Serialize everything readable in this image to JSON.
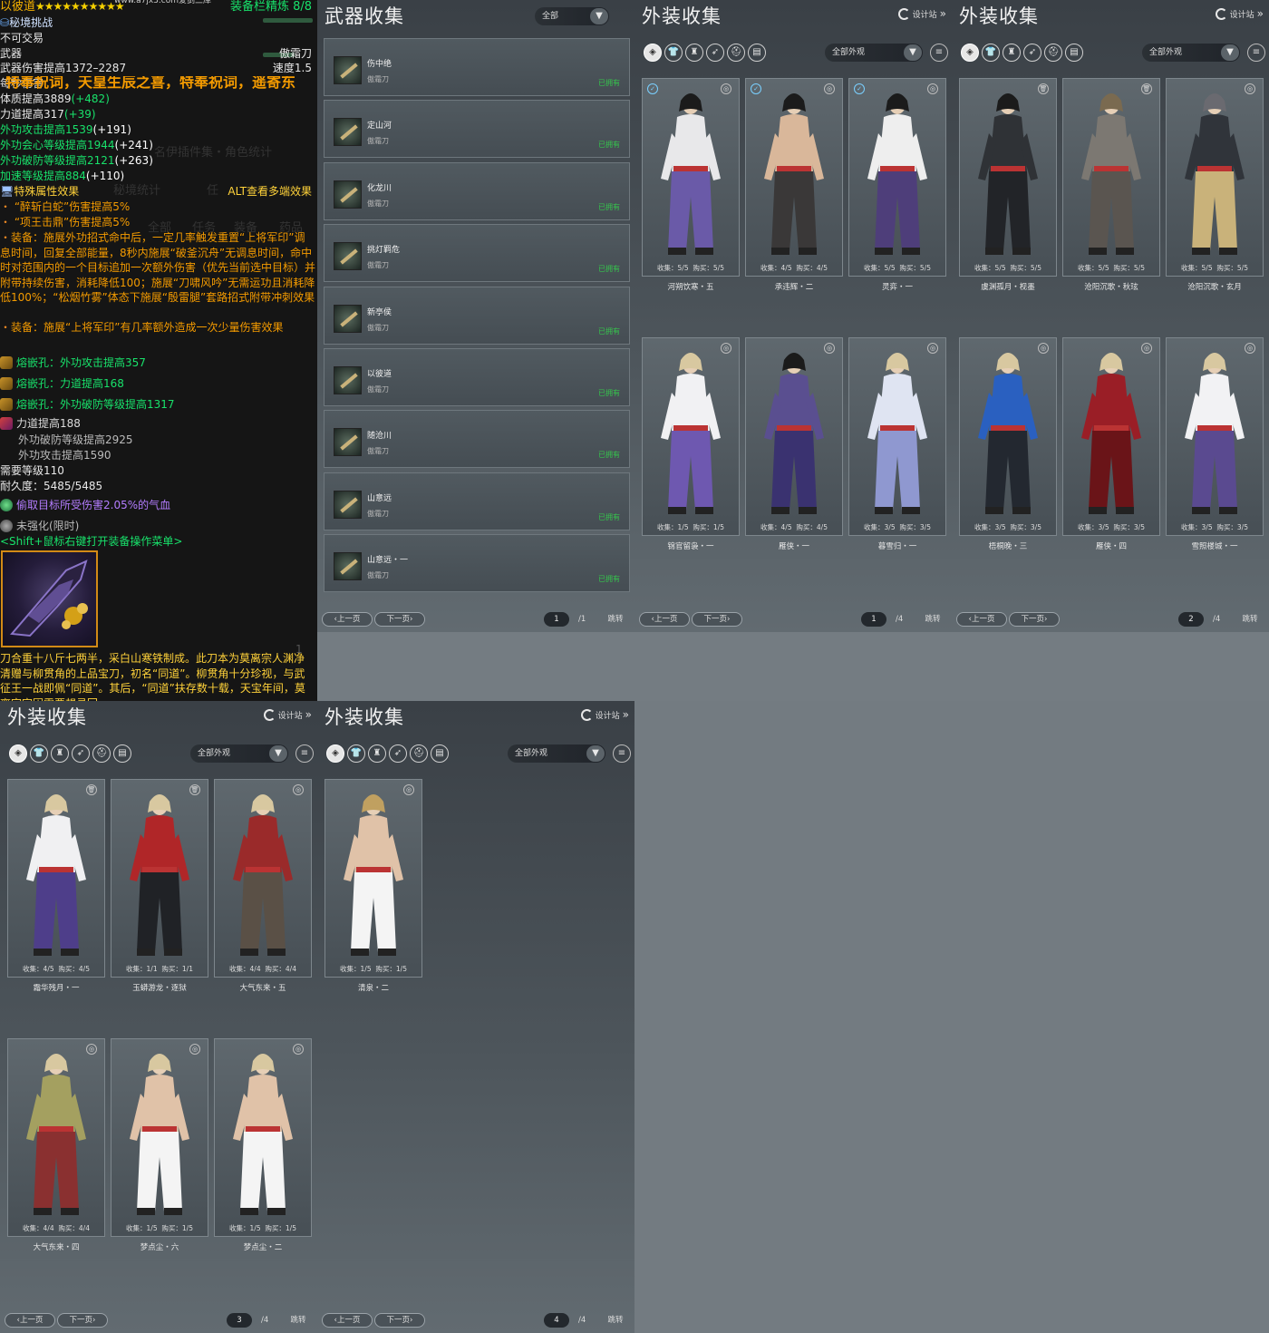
{
  "tooltip": {
    "watermark": "www.a7jx3.com爱剑三库",
    "name": "以彼道",
    "stars": "★★★★★★★★★★",
    "refine": "装备栏精炼 8/8",
    "challenge": "秘境挑战",
    "untradeable": "不可交易",
    "type": "武器",
    "weapon_class": "傲霜刀",
    "damage": "武器伤害提高1372–2287",
    "speed": "速度1.5",
    "dps": "每秒伤害",
    "banner": "特奉祝词，天皇生辰之喜，特奉祝词，遥寄东",
    "attrs": [
      {
        "text": "体质提高3889",
        "bonus": "(+482)"
      },
      {
        "text": "力道提高317",
        "bonus": "(+39)"
      }
    ],
    "green_attrs": [
      {
        "text": "外功攻击提高1539",
        "bonus": "(+191)"
      },
      {
        "text": "外功会心等级提高1944",
        "bonus": "(+241)"
      },
      {
        "text": "外功破防等级提高2121",
        "bonus": "(+263)"
      },
      {
        "text": "加速等级提高884",
        "bonus": "(+110)"
      }
    ],
    "special_header": "特殊属性效果",
    "alt_hint": "ALT查看多端效果",
    "special_effects": [
      "“醉斩白蛇”伤害提高5%",
      "“项王击鼎”伤害提高5%"
    ],
    "equip_effect_1": "装备：施展外功招式命中后，一定几率触发重置“上将军印”调息时间，回复全部能量，8秒内施展“破釜沉舟”无调息时间，命中时对范围内的一个目标追加一次额外伤害（优先当前选中目标）并附带持续伤害，消耗降低100；施展“刀啸风吟”无需运功且消耗降低100%；“松烟竹雾”体态下施展“殷雷腿”套路招式附带冲刺效果",
    "equip_effect_2": "装备：施展“上将军印”有几率额外造成一次少量伤害效果",
    "sockets": [
      "熔嵌孔：外功攻击提高357",
      "熔嵌孔：力道提高168",
      "熔嵌孔：外功破防等级提高1317"
    ],
    "enchant": [
      "力道提高188",
      "外功破防等级提高2925",
      "外功攻击提高1590"
    ],
    "level": "需要等级110",
    "durability": "耐久度：5485/5485",
    "gem_effect": "偷取目标所受伤害2.05%的气血",
    "strengthen": "未强化(限时)",
    "shift_hint": "<Shift+鼠标右键打开装备操作菜单>",
    "page_mark": "1",
    "flavor": "刀合重十八斤七两半，采白山寒铁制成。此刀本为莫离宗人渊净清赠与柳贯角的上品宝刀，初名“同道”。柳贯角十分珍视，与武征王一战即佩“同道”。其后，“同道”扶存数十载，天宝年间，莫离宗宗因需要想寻回",
    "ghost": [
      "名伊插件集・角色统计",
      "秘境统计",
      "任",
      "全部",
      "任务",
      "装备",
      "药品"
    ]
  },
  "weapon_panel": {
    "title": "武器收集",
    "filter": "全部",
    "items": [
      {
        "name": "伤中绝",
        "sub": "傲霜刀",
        "status": "已拥有"
      },
      {
        "name": "定山河",
        "sub": "傲霜刀",
        "status": "已拥有"
      },
      {
        "name": "化龙川",
        "sub": "傲霜刀",
        "status": "已拥有"
      },
      {
        "name": "挑灯羁危",
        "sub": "傲霜刀",
        "status": "已拥有"
      },
      {
        "name": "新亭侯",
        "sub": "傲霜刀",
        "status": "已拥有"
      },
      {
        "name": "以彼道",
        "sub": "傲霜刀",
        "status": "已拥有"
      },
      {
        "name": "随沧川",
        "sub": "傲霜刀",
        "status": "已拥有"
      },
      {
        "name": "山意远",
        "sub": "傲霜刀",
        "status": "已拥有"
      },
      {
        "name": "山意远・一",
        "sub": "傲霜刀",
        "status": "已拥有"
      }
    ],
    "page": "1",
    "total": "/1"
  },
  "common": {
    "outfit_title": "外装收集",
    "designer": "设计站",
    "outfit_filter": "全部外观",
    "prev": "上一页",
    "next": "下一页",
    "jump": "跳转",
    "collect_label": "收集：",
    "buy_label": "购买：",
    "categories": [
      "frame-icon",
      "shirt-icon",
      "trophy-icon",
      "feather-icon",
      "hat-icon",
      "book-icon"
    ]
  },
  "outfit_panels": [
    {
      "page": "1",
      "total": "/4",
      "items": [
        {
          "name": "河朔饮寒・五",
          "collect": "5/5",
          "buy": "5/5",
          "top": "#e8e8ea",
          "bottom": "#6a5aa8",
          "hair": "#1b1b1b"
        },
        {
          "name": "承违辉・二",
          "collect": "4/5",
          "buy": "4/5",
          "top": "#d9b79a",
          "bottom": "#3a3838",
          "hair": "#1b1b1b"
        },
        {
          "name": "灵弈・一",
          "collect": "5/5",
          "buy": "5/5",
          "top": "#eeeeee",
          "bottom": "#4e3e7a",
          "hair": "#1b1b1b"
        },
        {
          "name": "锦官留袅・一",
          "collect": "1/5",
          "buy": "1/5",
          "top": "#f1f1f3",
          "bottom": "#6e58b0",
          "hair": "#d8c8a0"
        },
        {
          "name": "雁侠・一",
          "collect": "4/5",
          "buy": "4/5",
          "top": "#5a4f90",
          "bottom": "#3a3270",
          "hair": "#1b1b1b"
        },
        {
          "name": "暮雪归・一",
          "collect": "3/5",
          "buy": "3/5",
          "top": "#dfe4f2",
          "bottom": "#8f98d0",
          "hair": "#d8c8a0"
        }
      ]
    },
    {
      "page": "2",
      "total": "/4",
      "items": [
        {
          "name": "虞渊孤月・枧墨",
          "collect": "5/5",
          "buy": "5/5",
          "top": "#2f3236",
          "bottom": "#222428",
          "hair": "#1b1b1b"
        },
        {
          "name": "沧阳沉歌・秋玹",
          "collect": "5/5",
          "buy": "5/5",
          "top": "#7c7872",
          "bottom": "#5a5550",
          "hair": "#7a6a50"
        },
        {
          "name": "沧阳沉歌・玄月",
          "collect": "5/5",
          "buy": "5/5",
          "top": "#30343a",
          "bottom": "#c9b27a",
          "hair": "#6a6a70"
        },
        {
          "name": "梧桐晚・三",
          "collect": "3/5",
          "buy": "3/5",
          "top": "#2a60c0",
          "bottom": "#232830",
          "hair": "#d8c8a0"
        },
        {
          "name": "雁侠・四",
          "collect": "3/5",
          "buy": "3/5",
          "top": "#9a1e26",
          "bottom": "#6a1418",
          "hair": "#d8c8a0"
        },
        {
          "name": "雪照楼城・一",
          "collect": "3/5",
          "buy": "3/5",
          "top": "#f2f2f4",
          "bottom": "#5a4a90",
          "hair": "#d8c8a0"
        }
      ]
    },
    {
      "page": "3",
      "total": "/4",
      "items": [
        {
          "name": "霜华残月・一",
          "collect": "4/5",
          "buy": "4/5",
          "top": "#f0f0f2",
          "bottom": "#4e3e8a",
          "hair": "#d8c8a0"
        },
        {
          "name": "玉蟒游龙・逐狱",
          "collect": "1/1",
          "buy": "1/1",
          "top": "#b02628",
          "bottom": "#202226",
          "hair": "#d8c8a0"
        },
        {
          "name": "大气东来・五",
          "collect": "4/4",
          "buy": "4/4",
          "top": "#9a2a2a",
          "bottom": "#5a5046",
          "hair": "#d8c8a0"
        },
        {
          "name": "大气东来・四",
          "collect": "4/4",
          "buy": "4/4",
          "top": "#a4a060",
          "bottom": "#8a3030",
          "hair": "#d8c8a0"
        },
        {
          "name": "梦点尘・六",
          "collect": "1/5",
          "buy": "1/5",
          "top": "#e0c2a8",
          "bottom": "#f4f4f4",
          "hair": "#d8c8a0"
        },
        {
          "name": "梦点尘・二",
          "collect": "1/5",
          "buy": "1/5",
          "top": "#e0c2a8",
          "bottom": "#f4f4f4",
          "hair": "#d8c8a0"
        }
      ]
    },
    {
      "page": "4",
      "total": "/4",
      "items": [
        {
          "name": "清泉・二",
          "collect": "1/5",
          "buy": "1/5",
          "top": "#e0c2a8",
          "bottom": "#f4f4f4",
          "hair": "#c0a060"
        }
      ]
    }
  ]
}
